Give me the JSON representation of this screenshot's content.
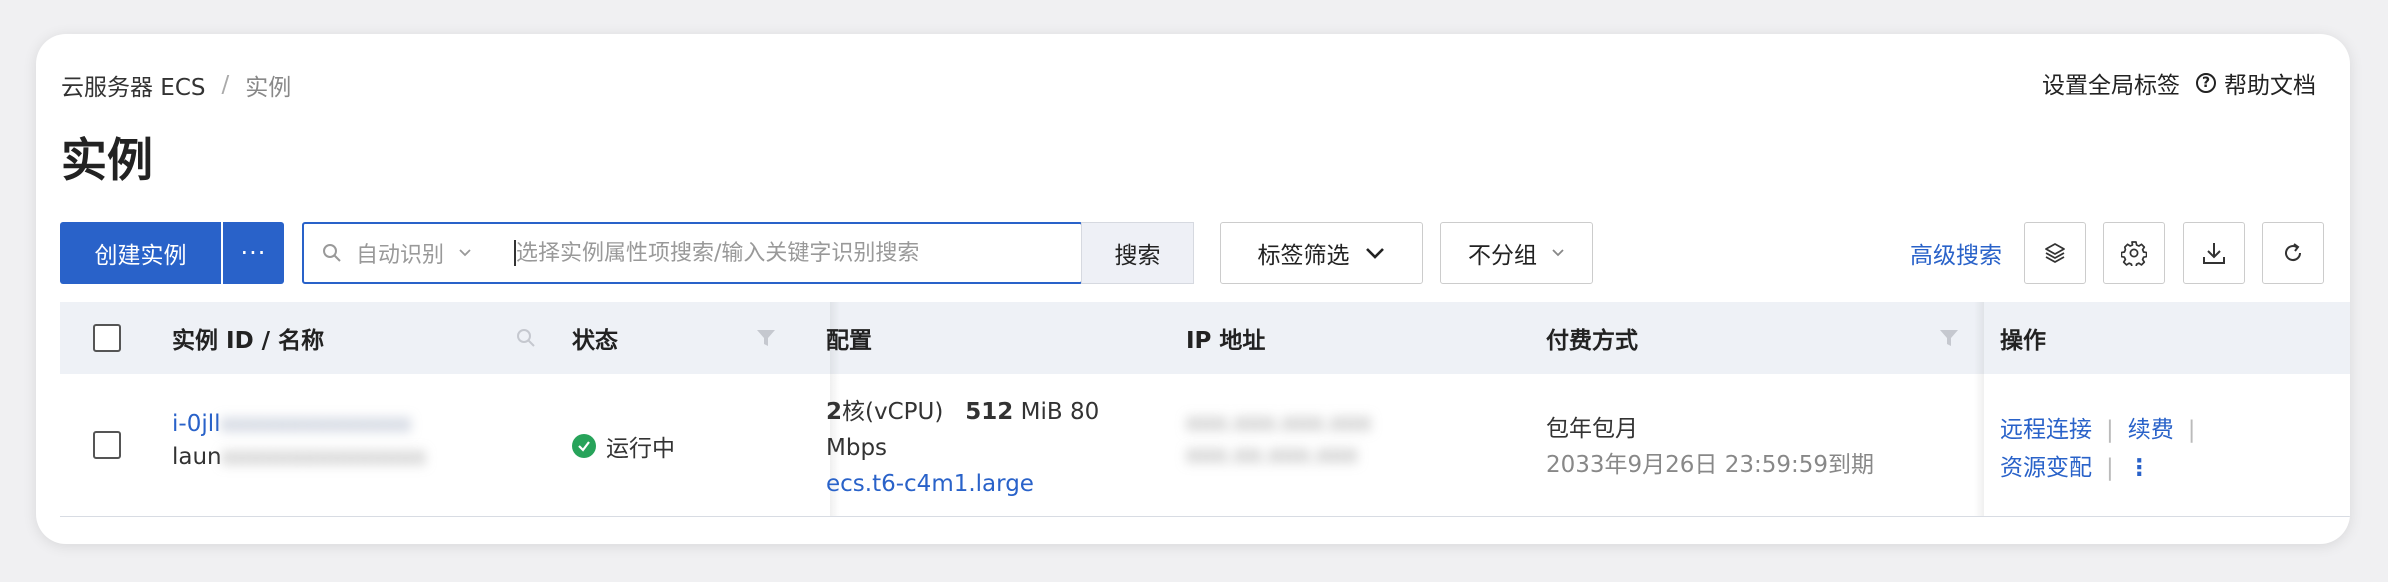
{
  "breadcrumb": {
    "root": "云服务器 ECS",
    "separator": "/",
    "current": "实例"
  },
  "header_links": {
    "global_tags": "设置全局标签",
    "help_doc": "帮助文档"
  },
  "page_title": "实例",
  "toolbar": {
    "create_label": "创建实例",
    "more_label": "···",
    "search_mode": "自动识别",
    "search_placeholder": "选择实例属性项搜索/输入关键字识别搜索",
    "search_button": "搜索",
    "tag_filter": "标签筛选",
    "group_select": "不分组",
    "advanced_search": "高级搜索"
  },
  "table": {
    "columns": {
      "instance": "实例 ID / 名称",
      "status": "状态",
      "config": "配置",
      "ip": "IP 地址",
      "billing": "付费方式",
      "actions": "操作"
    },
    "rows": [
      {
        "instance_id": "i-0jll",
        "instance_id_hidden": "xxxxxxxxxxxxxx",
        "instance_name": "laun",
        "instance_name_hidden": "xxxxxxxxxxxxxxx",
        "status": "运行中",
        "cpu_value": "2",
        "cpu_unit": "核(vCPU)",
        "mem_value": "512",
        "mem_unit": "MiB",
        "bandwidth_value": "80",
        "bandwidth_unit": "Mbps",
        "instance_type": "ecs.t6-c4m1.large",
        "ip_public_hidden": "xxx.xxx.xxx.xxx",
        "ip_private_hidden": "xxx.xx.xxx.xxx",
        "billing_type": "包年包月",
        "expiry": "2033年9月26日 23:59:59到期",
        "action_remote": "远程连接",
        "action_renew": "续费",
        "action_change": "资源变配"
      }
    ]
  },
  "colors": {
    "primary": "#2962c9",
    "success": "#27a35a"
  }
}
